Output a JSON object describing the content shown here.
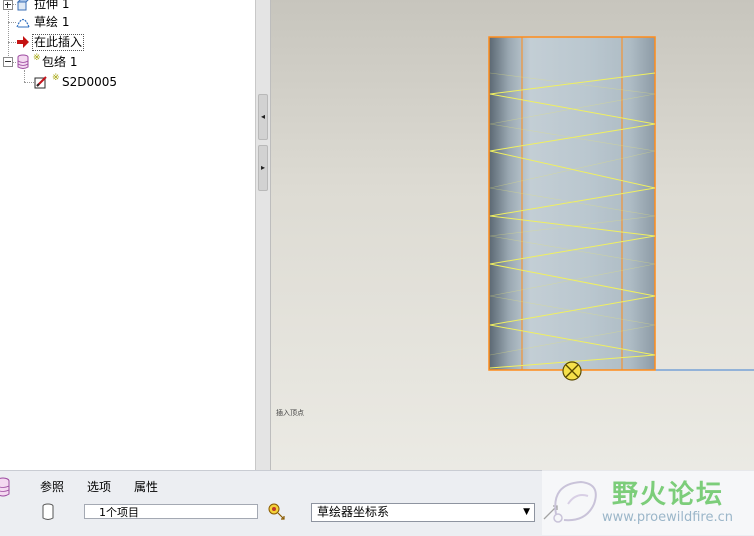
{
  "model_tree": {
    "items": [
      {
        "label": "拉伸 1",
        "icon": "extrude-icon"
      },
      {
        "label": "草绘 1",
        "icon": "sketch-icon"
      },
      {
        "label": "在此插入",
        "icon": "insert-here-arrow-icon"
      },
      {
        "label": "包络 1",
        "icon": "wrap-feature-icon"
      },
      {
        "label": "S2D0005",
        "icon": "sketch-section-icon"
      }
    ]
  },
  "graphics": {
    "small_label": "插入顶点"
  },
  "dashboard": {
    "tabs": [
      "参照",
      "选项",
      "属性"
    ],
    "reference_value": "1个项目",
    "coordinate_system_option": "草绘器坐标系"
  },
  "watermark": {
    "title": "野火论坛",
    "url": "www.proewildfire.cn"
  },
  "colors": {
    "highlight_edge": "#ff8c1a",
    "wrapped_curve": "#f0f060",
    "cylinder_body": "#b6c4cc"
  }
}
